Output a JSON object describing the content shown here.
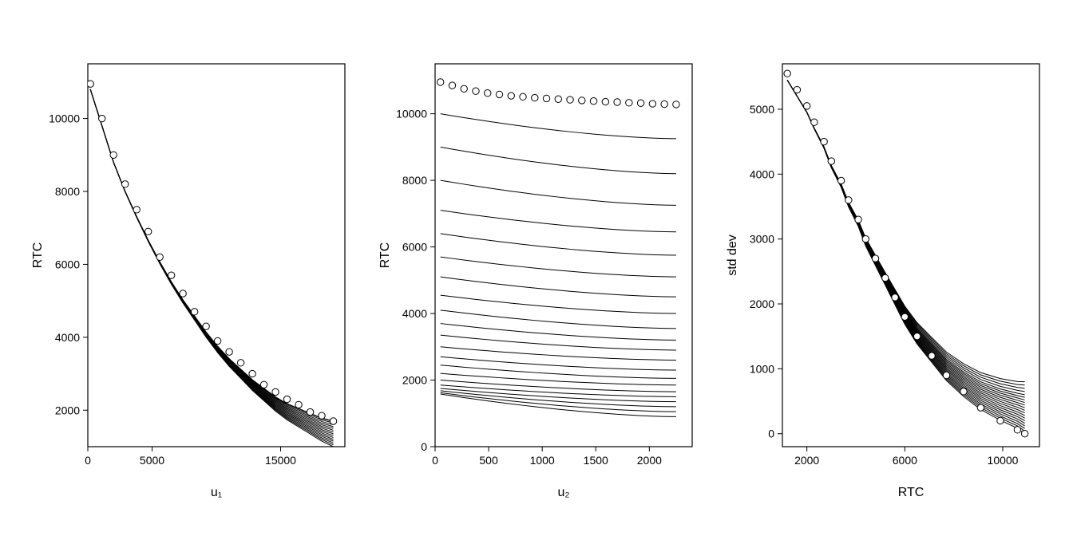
{
  "chart_data": [
    {
      "type": "line",
      "xlabel": "u₁",
      "ylabel": "RTC",
      "xlim": [
        0,
        20000
      ],
      "ylim": [
        1000,
        11500
      ],
      "xticks": [
        0,
        5000,
        15000
      ],
      "yticks": [
        2000,
        4000,
        6000,
        8000,
        10000
      ],
      "points": {
        "x": [
          200,
          1100,
          2000,
          2900,
          3800,
          4700,
          5600,
          6500,
          7400,
          8300,
          9200,
          10100,
          11000,
          11900,
          12800,
          13700,
          14600,
          15500,
          16400,
          17300,
          18200,
          19100
        ],
        "y": [
          10950,
          10000,
          9000,
          8200,
          7500,
          6900,
          6200,
          5700,
          5200,
          4700,
          4300,
          3900,
          3600,
          3300,
          3000,
          2700,
          2500,
          2300,
          2150,
          1950,
          1850,
          1700
        ]
      },
      "series_family": {
        "x": [
          200,
          1100,
          2000,
          2900,
          3800,
          4700,
          5600,
          6500,
          7400,
          8300,
          9200,
          10100,
          11000,
          11900,
          12800,
          13700,
          14600,
          15500,
          16400,
          17300,
          18200,
          19100
        ],
        "curves_end_y": [
          1000,
          1050,
          1100,
          1150,
          1200,
          1250,
          1300,
          1350,
          1400,
          1450,
          1500,
          1550,
          1600,
          1650,
          1700,
          1700,
          1700,
          1700,
          1700,
          1700
        ],
        "y_start": 10800,
        "shape_ref_y": [
          10800,
          9800,
          8800,
          8000,
          7300,
          6650,
          6050,
          5500,
          5000,
          4550,
          4100,
          3700,
          3350,
          3050,
          2750,
          2500,
          2250,
          2050,
          1900,
          1750,
          1600,
          1500
        ]
      }
    },
    {
      "type": "line",
      "xlabel": "u₂",
      "ylabel": "RTC",
      "xlim": [
        0,
        2400
      ],
      "ylim": [
        0,
        11500
      ],
      "xticks": [
        0,
        500,
        1000,
        1500,
        2000
      ],
      "yticks": [
        0,
        2000,
        4000,
        6000,
        8000,
        10000
      ],
      "points": {
        "x": [
          50,
          160,
          270,
          380,
          490,
          600,
          710,
          820,
          930,
          1040,
          1150,
          1260,
          1370,
          1480,
          1590,
          1700,
          1810,
          1920,
          2030,
          2140,
          2250
        ],
        "y": [
          10950,
          10850,
          10750,
          10680,
          10620,
          10580,
          10540,
          10510,
          10480,
          10460,
          10440,
          10420,
          10400,
          10380,
          10360,
          10350,
          10330,
          10320,
          10300,
          10290,
          10280
        ]
      },
      "series": [
        {
          "y_start": 10000,
          "y_end": 9250
        },
        {
          "y_start": 9000,
          "y_end": 8200
        },
        {
          "y_start": 8000,
          "y_end": 7250
        },
        {
          "y_start": 7100,
          "y_end": 6450
        },
        {
          "y_start": 6400,
          "y_end": 5750
        },
        {
          "y_start": 5700,
          "y_end": 5100
        },
        {
          "y_start": 5100,
          "y_end": 4500
        },
        {
          "y_start": 4550,
          "y_end": 4000
        },
        {
          "y_start": 4100,
          "y_end": 3550
        },
        {
          "y_start": 3700,
          "y_end": 3200
        },
        {
          "y_start": 3350,
          "y_end": 2900
        },
        {
          "y_start": 3000,
          "y_end": 2600
        },
        {
          "y_start": 2700,
          "y_end": 2300
        },
        {
          "y_start": 2450,
          "y_end": 2050
        },
        {
          "y_start": 2200,
          "y_end": 1850
        },
        {
          "y_start": 2000,
          "y_end": 1650
        },
        {
          "y_start": 1850,
          "y_end": 1500
        },
        {
          "y_start": 1750,
          "y_end": 1350
        },
        {
          "y_start": 1680,
          "y_end": 1200
        },
        {
          "y_start": 1620,
          "y_end": 1050
        },
        {
          "y_start": 1580,
          "y_end": 900
        }
      ]
    },
    {
      "type": "line",
      "xlabel": "RTC",
      "ylabel": "std dev",
      "xlim": [
        1000,
        11500
      ],
      "ylim": [
        -200,
        5700
      ],
      "xticks": [
        2000,
        6000,
        10000
      ],
      "yticks": [
        0,
        1000,
        2000,
        3000,
        4000,
        5000
      ],
      "points": {
        "x": [
          1200,
          1600,
          2000,
          2300,
          2700,
          3000,
          3400,
          3700,
          4100,
          4400,
          4800,
          5200,
          5600,
          6000,
          6500,
          7100,
          7700,
          8400,
          9100,
          9900,
          10600,
          10900
        ],
        "y": [
          5550,
          5300,
          5050,
          4800,
          4500,
          4200,
          3900,
          3600,
          3300,
          3000,
          2700,
          2400,
          2100,
          1800,
          1500,
          1200,
          900,
          650,
          400,
          200,
          60,
          0
        ]
      },
      "series_family": {
        "x": [
          1200,
          1600,
          2000,
          2300,
          2700,
          3000,
          3400,
          3700,
          4100,
          4400,
          4800,
          5200,
          5600,
          6000,
          6500,
          7100,
          7700,
          8400,
          9100,
          9900,
          10600,
          10900
        ],
        "curves_end_y": [
          0,
          40,
          80,
          120,
          160,
          200,
          240,
          280,
          320,
          360,
          400,
          440,
          480,
          520,
          560,
          600,
          650,
          700,
          750,
          800
        ],
        "y_start": 5450,
        "shape_ref_y": [
          5450,
          5200,
          4950,
          4700,
          4400,
          4100,
          3800,
          3500,
          3200,
          2900,
          2600,
          2300,
          2000,
          1700,
          1400,
          1120,
          840,
          600,
          400,
          240,
          120,
          40
        ]
      }
    }
  ]
}
